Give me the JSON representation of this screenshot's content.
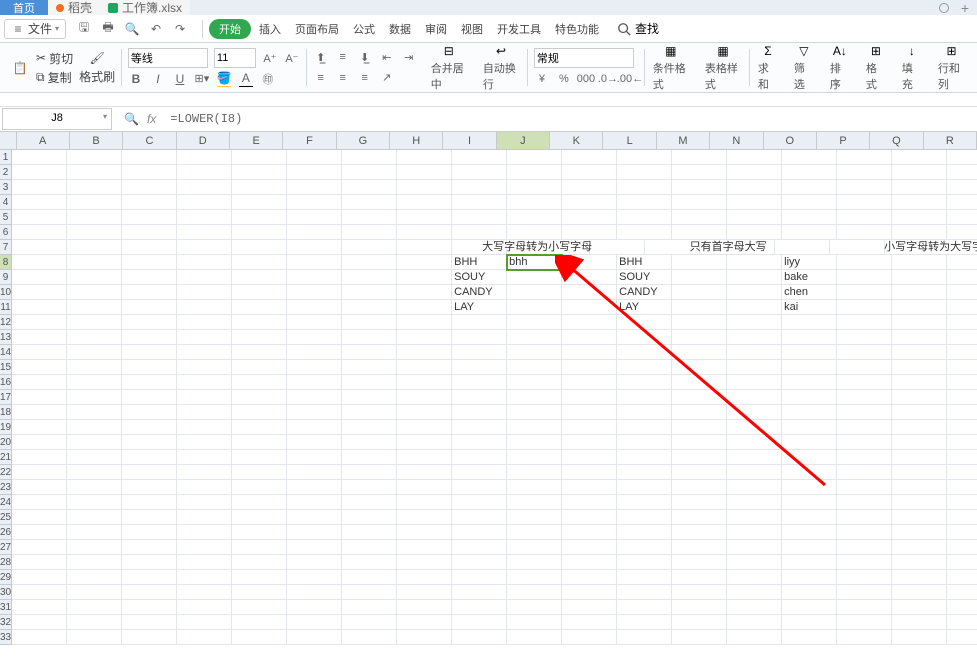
{
  "tabs": {
    "home": "首页",
    "orange": "稻壳",
    "green": "工作簿.xlsx"
  },
  "menubar": {
    "file": "文件",
    "items": [
      "开始",
      "插入",
      "页面布局",
      "公式",
      "数据",
      "审阅",
      "视图",
      "开发工具",
      "特色功能"
    ],
    "active_index": 0,
    "search": "查找"
  },
  "ribbon": {
    "clipboard": {
      "cut": "剪切",
      "copy": "复制",
      "format_painter": "格式刷"
    },
    "font": {
      "name": "等线",
      "size": "11"
    },
    "alignment": {
      "merge": "合并居中",
      "wrap": "自动换行"
    },
    "number": {
      "format": "常规"
    },
    "styles": {
      "cond_format": "条件格式",
      "cell_style": "表格样式"
    },
    "editing": {
      "sum": "求和",
      "filter": "筛选",
      "sort": "排序",
      "format": "格式",
      "fill": "填充",
      "rowcol": "行和列"
    }
  },
  "formula_bar": {
    "name_box": "J8",
    "formula": "=LOWER(I8)"
  },
  "grid": {
    "columns": [
      "A",
      "B",
      "C",
      "D",
      "E",
      "F",
      "G",
      "H",
      "I",
      "J",
      "K",
      "L",
      "M",
      "N",
      "O",
      "P",
      "Q",
      "R"
    ],
    "selected_col": "J",
    "selected_row_index": 7,
    "visible_rows": 33,
    "row_labels_start": 1,
    "headers": {
      "J7": "大写字母转为小写字母",
      "M7": "只有首字母大写",
      "P7": "小写字母转为大写字母"
    },
    "data_I": [
      "BHH",
      "SOUY",
      "CANDY",
      "LAY"
    ],
    "data_J8": "bhh",
    "data_L": [
      "BHH",
      "SOUY",
      "CANDY",
      "LAY"
    ],
    "data_O": [
      "liyy",
      "bake",
      "chen",
      "kai"
    ]
  }
}
